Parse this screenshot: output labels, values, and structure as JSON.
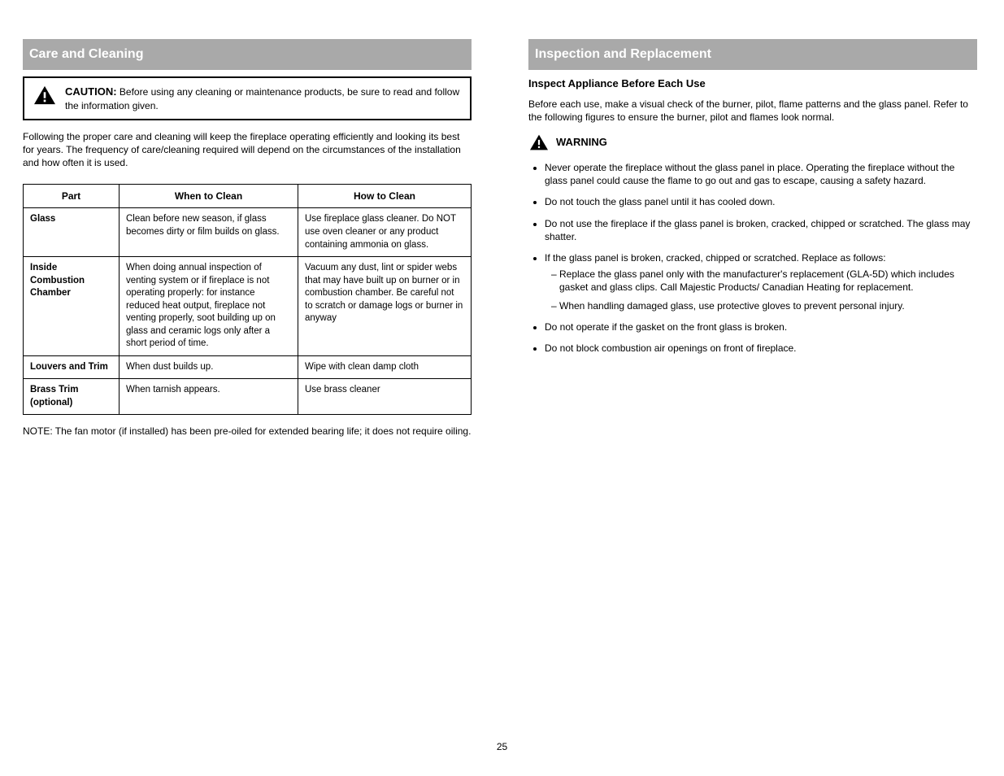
{
  "left": {
    "section_title": "Care and Cleaning",
    "warning_label": "CAUTION:",
    "warning_text": "Before using any cleaning or maintenance products, be sure to read and follow the information given.",
    "intro": "Following the proper care and cleaning will keep the fireplace operating efficiently and looking its best for years. The frequency of care/cleaning required will depend on the circumstances of the installation and how often it is used.",
    "table": {
      "headers": [
        "Part",
        "When to Clean",
        "How to Clean"
      ],
      "rows": [
        {
          "part": "Glass",
          "when": "Clean before new season, if glass becomes dirty or film builds on glass.",
          "how": "Use fireplace glass cleaner. Do NOT use oven cleaner or any product containing ammonia on glass."
        },
        {
          "part": "Inside Combustion Chamber",
          "when": "When doing annual inspection of venting system or if fireplace is not operating properly: for instance reduced heat output, fireplace not venting properly, soot building up on glass and ceramic logs only after a short period of time.",
          "how": "Vacuum any dust, lint or spider webs that may have built up on burner or in combustion chamber. Be careful not to scratch or damage logs or burner in anyway"
        },
        {
          "part": "Louvers and Trim",
          "when": "When dust builds up.",
          "how": "Wipe with clean damp cloth"
        },
        {
          "part": "Brass Trim (optional)",
          "when": "When tarnish appears.",
          "how": "Use brass cleaner"
        }
      ]
    },
    "note": "NOTE: The fan motor (if installed) has been pre-oiled for extended bearing life; it does not require oiling."
  },
  "right": {
    "section_title": "Inspection and Replacement",
    "subhead": "Inspect Appliance Before Each Use",
    "para": "Before each use, make a visual check of the burner, pilot, flame patterns and the glass panel. Refer to the following figures to ensure the burner, pilot and flames look normal.",
    "warning_label": "WARNING",
    "bullets": [
      "Never operate the fireplace without the glass panel in place. Operating the fireplace without the glass panel could cause the flame to go out and gas to escape, causing a safety hazard.",
      "Do not touch the glass panel until it has cooled down.",
      "Do not use the fireplace if the glass panel is broken, cracked, chipped or scratched. The glass may shatter.",
      {
        "text": "If the glass panel is broken, cracked, chipped or scratched. Replace as follows:",
        "subs": [
          "Replace the glass panel only with the manufacturer's replacement (GLA-5D) which includes gasket and glass clips. Call Majestic Products/ Canadian Heating for replacement.",
          "When handling damaged glass, use protective gloves to prevent personal injury."
        ]
      },
      "Do not operate if the gasket on the front glass is broken.",
      "Do not block combustion air openings on front of fireplace."
    ]
  },
  "page_number": "25"
}
